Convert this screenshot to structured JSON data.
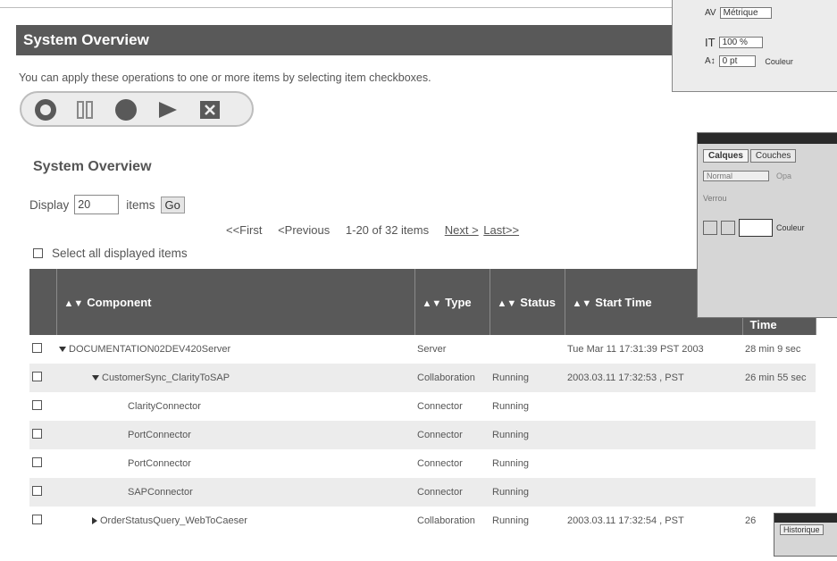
{
  "page": {
    "title": "System Overview",
    "help_text": "You can apply these operations to one or more items by selecting item checkboxes."
  },
  "panel": {
    "title": "System Overview",
    "display_label": "Display",
    "display_value": "20",
    "items_label": "items",
    "go_label": "Go",
    "pager": {
      "first": "<<First",
      "previous": "<Previous",
      "range": "1-20 of 32 items",
      "next": "Next >",
      "last": "Last>>"
    },
    "select_all": "Select all displayed items"
  },
  "table": {
    "headers": {
      "component": "Component",
      "type": "Type",
      "status": "Status",
      "start_time": "Start Time",
      "time": "Time"
    },
    "rows": [
      {
        "component": "DOCUMENTATION02DEV420Server",
        "type": "Server",
        "status": "",
        "start": "Tue Mar 11 17:31:39 PST 2003",
        "elapsed": "28 min 9 sec"
      },
      {
        "component": "CustomerSync_ClarityToSAP",
        "type": "Collaboration",
        "status": "Running",
        "start": "2003.03.11 17:32:53 , PST",
        "elapsed": "26 min 55 sec"
      },
      {
        "component": "ClarityConnector",
        "type": "Connector",
        "status": "Running",
        "start": "",
        "elapsed": ""
      },
      {
        "component": "PortConnector",
        "type": "Connector",
        "status": "Running",
        "start": "",
        "elapsed": ""
      },
      {
        "component": "PortConnector",
        "type": "Connector",
        "status": "Running",
        "start": "",
        "elapsed": ""
      },
      {
        "component": "SAPConnector",
        "type": "Connector",
        "status": "Running",
        "start": "",
        "elapsed": ""
      },
      {
        "component": "OrderStatusQuery_WebToCaeser",
        "type": "Collaboration",
        "status": "Running",
        "start": "2003.03.11 17:32:54 , PST",
        "elapsed": "26"
      }
    ]
  },
  "overlay": {
    "metric": "Métrique",
    "scale": "100 %",
    "baseline": "0 pt",
    "color_label": "Couleur",
    "tab_layers": "Calques",
    "tab_channels": "Couches",
    "blend_mode": "Normal",
    "opacity_label": "Opa",
    "lock_label": "Verrou",
    "layer_name": "Couleur",
    "history_label": "Historique"
  }
}
